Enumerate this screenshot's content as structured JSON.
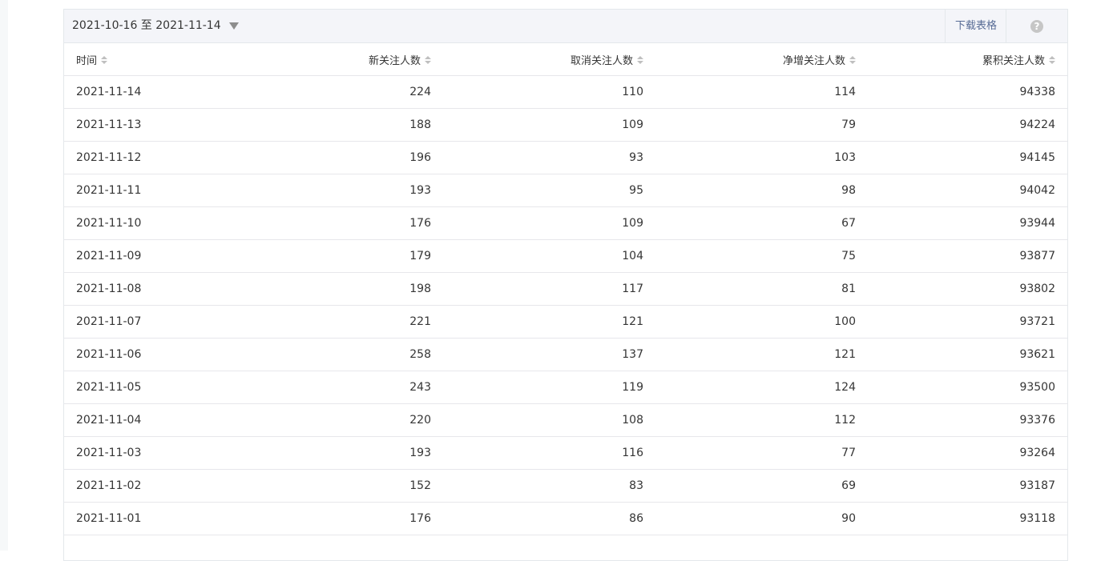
{
  "toolbar": {
    "date_range": "2021-10-16 至 2021-11-14",
    "download_label": "下载表格",
    "help_symbol": "?"
  },
  "table": {
    "headers": [
      "时间",
      "新关注人数",
      "取消关注人数",
      "净增关注人数",
      "累积关注人数"
    ],
    "rows": [
      [
        "2021-11-14",
        "224",
        "110",
        "114",
        "94338"
      ],
      [
        "2021-11-13",
        "188",
        "109",
        "79",
        "94224"
      ],
      [
        "2021-11-12",
        "196",
        "93",
        "103",
        "94145"
      ],
      [
        "2021-11-11",
        "193",
        "95",
        "98",
        "94042"
      ],
      [
        "2021-11-10",
        "176",
        "109",
        "67",
        "93944"
      ],
      [
        "2021-11-09",
        "179",
        "104",
        "75",
        "93877"
      ],
      [
        "2021-11-08",
        "198",
        "117",
        "81",
        "93802"
      ],
      [
        "2021-11-07",
        "221",
        "121",
        "100",
        "93721"
      ],
      [
        "2021-11-06",
        "258",
        "137",
        "121",
        "93621"
      ],
      [
        "2021-11-05",
        "243",
        "119",
        "124",
        "93500"
      ],
      [
        "2021-11-04",
        "220",
        "108",
        "112",
        "93376"
      ],
      [
        "2021-11-03",
        "193",
        "116",
        "77",
        "93264"
      ],
      [
        "2021-11-02",
        "152",
        "83",
        "69",
        "93187"
      ],
      [
        "2021-11-01",
        "176",
        "86",
        "90",
        "93118"
      ]
    ]
  },
  "colors": {
    "link": "#576b95",
    "border": "#e4e8eb",
    "toolbar_bg": "#f4f5f9",
    "text": "#353535"
  }
}
